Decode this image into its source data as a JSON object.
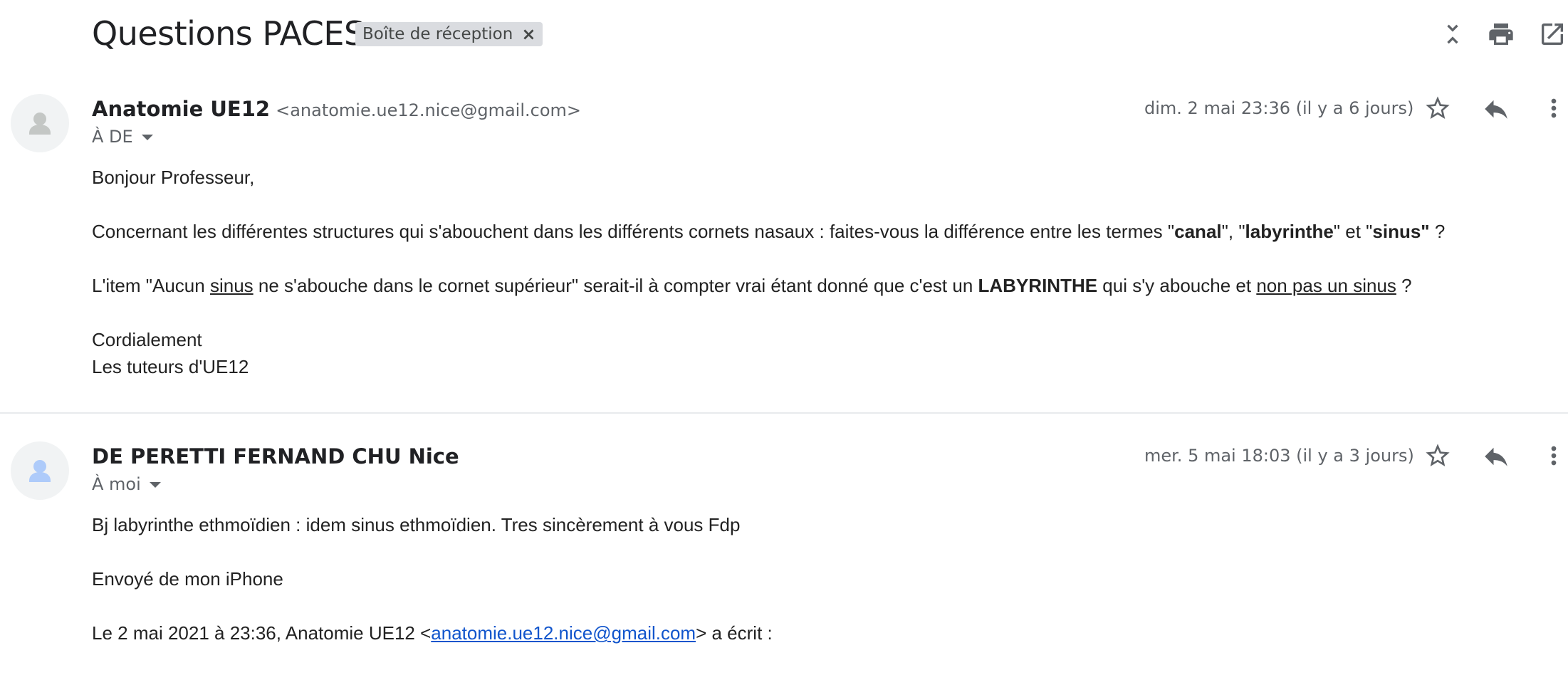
{
  "header": {
    "subject": "Questions PACES",
    "label": "Boîte de réception",
    "label_remove": "×"
  },
  "message1": {
    "sender_name": "Anatomie UE12",
    "sender_email": "<anatomie.ue12.nice@gmail.com>",
    "recipient": "À DE",
    "date": "dim. 2 mai 23:36 (il y a 6 jours)",
    "greeting": "Bonjour Professeur,",
    "p1": {
      "a": "Concernant les différentes structures qui s'abouchent dans les différents cornets nasaux : faites-vous la différence entre les termes \"",
      "b": "canal",
      "c": "\", \"",
      "d": "labyrinthe",
      "e": "\" et \"",
      "f": "sinus\"",
      "g": " ?"
    },
    "p2": {
      "a": "L'item \"Aucun ",
      "b": "sinus",
      "c": " ne s'abouche dans le cornet supérieur\" serait-il à compter vrai étant donné que c'est un ",
      "d": "LABYRINTHE",
      "e": " qui s'y abouche et ",
      "f": "non pas un sinus",
      "g": " ?"
    },
    "closing1": "Cordialement",
    "closing2": "Les tuteurs d'UE12"
  },
  "message2": {
    "sender_name": "DE PERETTI FERNAND CHU Nice",
    "recipient": "À moi",
    "date": "mer. 5 mai 18:03 (il y a 3 jours)",
    "line1": "Bj labyrinthe ethmoïdien : idem sinus ethmoïdien. Tres sincèrement à vous Fdp",
    "line2": "Envoyé de mon iPhone",
    "quote_prefix": "Le 2 mai 2021 à 23:36, Anatomie UE12 <",
    "quote_email": "anatomie.ue12.nice@gmail.com",
    "quote_suffix": "> a écrit :"
  },
  "icons": {
    "collapse": "collapse-all-icon",
    "print": "print-icon",
    "open_new": "open-in-new-window-icon",
    "star": "star-icon",
    "reply": "reply-icon",
    "more": "more-vert-icon",
    "avatar": "person-avatar-icon"
  },
  "colors": {
    "link": "#1155cc",
    "avatar_default": "#c4c7c5",
    "avatar_second": "#aecbfa"
  }
}
